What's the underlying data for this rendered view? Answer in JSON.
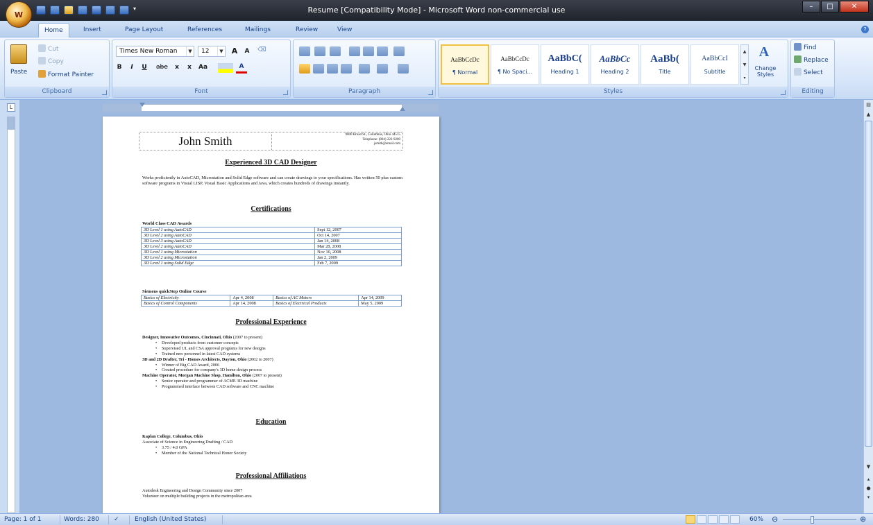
{
  "window": {
    "title": "Resume [Compatibility Mode] - Microsoft Word non-commercial use",
    "office_button_label": "W"
  },
  "tabs": [
    "Home",
    "Insert",
    "Page Layout",
    "References",
    "Mailings",
    "Review",
    "View"
  ],
  "clipboard": {
    "paste": "Paste",
    "cut": "Cut",
    "copy": "Copy",
    "format_painter": "Format Painter",
    "label": "Clipboard"
  },
  "font": {
    "family": "Times New Roman",
    "size": "12",
    "grow": "A",
    "shrink": "A",
    "bold": "B",
    "italic": "I",
    "underline": "U",
    "strike": "abe",
    "subscript": "x",
    "superscript": "x",
    "change_case": "Aa",
    "font_color": "A",
    "label": "Font"
  },
  "paragraph": {
    "label": "Paragraph"
  },
  "styles": {
    "items": [
      {
        "preview": "AaBbCcDc",
        "name": "¶ Normal"
      },
      {
        "preview": "AaBbCcDc",
        "name": "¶ No Spaci..."
      },
      {
        "preview": "AaBbC(",
        "name": "Heading 1"
      },
      {
        "preview": "AaBbCc",
        "name": "Heading 2"
      },
      {
        "preview": "AaBb(",
        "name": "Title"
      },
      {
        "preview": "AaBbCcI",
        "name": "Subtitle"
      }
    ],
    "change_styles": "Change Styles",
    "label": "Styles"
  },
  "editing": {
    "find": "Find",
    "replace": "Replace",
    "select": "Select",
    "label": "Editing"
  },
  "document": {
    "name": "John Smith",
    "address": [
      "9000 Broad St., Columbus, Ohio 44515",
      "Telephone: (804) 222-9200",
      "jsmith@email.com"
    ],
    "heading1": "Experienced 3D CAD Designer",
    "summary": "Works proficiently in AutoCAD, Microstation and Solid Edge software and can create drawings to your specifications. Has written 50 plus custom software programs in Visual LISP, Visual Basic Applications and Java, which creates hundreds of drawings instantly.",
    "heading2": "Certifications",
    "awards_title": "World Class CAD Awards",
    "awards": [
      [
        "3D Level 1 using AutoCAD",
        "Sept 12, 2007"
      ],
      [
        "3D Level 2 using AutoCAD",
        "Oct 14, 2007"
      ],
      [
        "3D Level 3 using AutoCAD",
        "Jan 14, 2008"
      ],
      [
        "3D Level 2 using AutoCAD",
        "Mar 28, 2008"
      ],
      [
        "3D Level 1 using Microstation",
        "Nov 10, 2008"
      ],
      [
        "3D Level 2 using Microstation",
        "Jan 2, 2009"
      ],
      [
        "3D Level 1 using Solid Edge",
        "Feb 7, 2009"
      ]
    ],
    "course_title": "Siemens quickStep Online Course",
    "courses": [
      [
        "Basics of Electricity",
        "Apr 4, 2008",
        "Basics of AC Motors",
        "Apr 14, 2009"
      ],
      [
        "Basics of Control Components",
        "Apr 14, 2008",
        "Basics of Electrical Products",
        "May 5, 2009"
      ]
    ],
    "heading3": "Professional Experience",
    "job1": {
      "title": "Designer, Innovative Outcomes, Cincinnati, Ohio",
      "dates": " (2007 to present)",
      "bullets": [
        "Developed products from customer concepts",
        "Supervised UL and CSA approval programs for new designs",
        "Trained new personnel in latest CAD systems"
      ]
    },
    "job2": {
      "title": "3D and 2D Drafter, Tri - Homes Architects, Dayton, Ohio",
      "dates": " (2002 to 2007)",
      "bullets": [
        "Winner of Big CAD Award, 2006",
        "Created procedure for company's 3D home design process"
      ]
    },
    "job3": {
      "title": "Machine Operator, Morgan Machine Shop, Hamilton, Ohio",
      "dates": " (2007 to present)",
      "bullets": [
        "Senior operator and programmer of ACME 3D machine",
        "Programmed interface between CAD software and CNC machine"
      ]
    },
    "heading4": "Education",
    "school": "Kaplan College, Columbus, Ohio",
    "degree": "Associate of Science in Engineering Drafting / CAD",
    "edu_bullets": [
      "3.75 / 4.0 GPA",
      "Member of the National Technical Honor Society"
    ],
    "heading5": "Professional Affiliations",
    "affil": [
      "Autodesk Engineering and Design Community since 2007",
      "Volunteer on multiple building projects in the metropolitan area"
    ]
  },
  "status": {
    "page": "Page: 1 of 1",
    "words": "Words: 280",
    "language": "English (United States)",
    "zoom": "60%"
  }
}
